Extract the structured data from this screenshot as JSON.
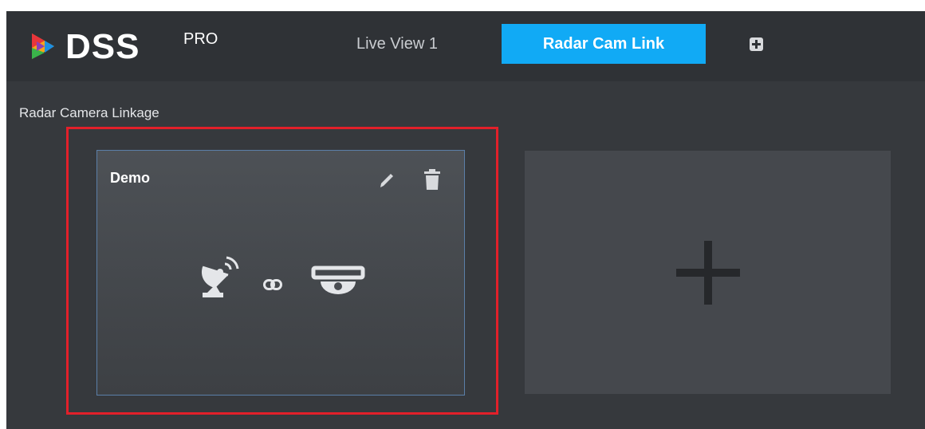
{
  "brand": {
    "name": "DSS",
    "edition": "PRO"
  },
  "tabs": [
    {
      "label": "Live View 1",
      "active": false
    },
    {
      "label": "Radar Cam Link",
      "active": true
    }
  ],
  "page": {
    "section_title": "Radar Camera Linkage"
  },
  "linkage_cards": [
    {
      "name": "Demo",
      "icons": [
        "radar-icon",
        "link-icon",
        "dome-camera-icon",
        "edit-icon",
        "delete-icon"
      ]
    }
  ],
  "colors": {
    "accent": "#11aaf5",
    "highlight": "#e2202a",
    "background": "#36393d",
    "header": "#2f3236",
    "card_border": "#5b7fa8"
  }
}
